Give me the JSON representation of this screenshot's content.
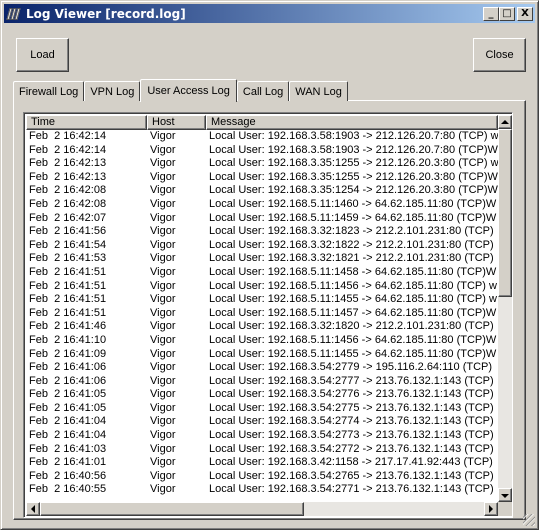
{
  "window": {
    "title": "Log Viewer [record.log]"
  },
  "title_buttons": {
    "minimize": "_",
    "maximize": "□",
    "close": "X"
  },
  "buttons": {
    "load": "Load",
    "close": "Close"
  },
  "tabs": [
    {
      "label": "Firewall Log",
      "active": false
    },
    {
      "label": "VPN Log",
      "active": false
    },
    {
      "label": "User Access Log",
      "active": true
    },
    {
      "label": "Call Log",
      "active": false
    },
    {
      "label": "WAN Log",
      "active": false
    }
  ],
  "table": {
    "columns": [
      "Time",
      "Host",
      "Message"
    ],
    "rows": [
      [
        "Feb  2 16:42:14",
        "Vigor",
        "Local User: 192.168.3.58:1903 -> 212.126.20.7:80 (TCP) w"
      ],
      [
        "Feb  2 16:42:14",
        "Vigor",
        "Local User: 192.168.3.58:1903 -> 212.126.20.7:80 (TCP)W"
      ],
      [
        "Feb  2 16:42:13",
        "Vigor",
        "Local User: 192.168.3.35:1255 -> 212.126.20.3:80 (TCP) w"
      ],
      [
        "Feb  2 16:42:13",
        "Vigor",
        "Local User: 192.168.3.35:1255 -> 212.126.20.3:80 (TCP)W"
      ],
      [
        "Feb  2 16:42:08",
        "Vigor",
        "Local User: 192.168.3.35:1254 -> 212.126.20.3:80 (TCP)W"
      ],
      [
        "Feb  2 16:42:08",
        "Vigor",
        "Local User: 192.168.5.11:1460 -> 64.62.185.11:80 (TCP)W"
      ],
      [
        "Feb  2 16:42:07",
        "Vigor",
        "Local User: 192.168.5.11:1459 -> 64.62.185.11:80 (TCP)W"
      ],
      [
        "Feb  2 16:41:56",
        "Vigor",
        "Local User: 192.168.3.32:1823 -> 212.2.101.231:80 (TCP)"
      ],
      [
        "Feb  2 16:41:54",
        "Vigor",
        "Local User: 192.168.3.32:1822 -> 212.2.101.231:80 (TCP)"
      ],
      [
        "Feb  2 16:41:53",
        "Vigor",
        "Local User: 192.168.3.32:1821 -> 212.2.101.231:80 (TCP)"
      ],
      [
        "Feb  2 16:41:51",
        "Vigor",
        "Local User: 192.168.5.11:1458 -> 64.62.185.11:80 (TCP)W"
      ],
      [
        "Feb  2 16:41:51",
        "Vigor",
        "Local User: 192.168.5.11:1456 -> 64.62.185.11:80 (TCP) w"
      ],
      [
        "Feb  2 16:41:51",
        "Vigor",
        "Local User: 192.168.5.11:1455 -> 64.62.185.11:80 (TCP) w"
      ],
      [
        "Feb  2 16:41:51",
        "Vigor",
        "Local User: 192.168.5.11:1457 -> 64.62.185.11:80 (TCP)W"
      ],
      [
        "Feb  2 16:41:46",
        "Vigor",
        "Local User: 192.168.3.32:1820 -> 212.2.101.231:80 (TCP)"
      ],
      [
        "Feb  2 16:41:10",
        "Vigor",
        "Local User: 192.168.5.11:1456 -> 64.62.185.11:80 (TCP)W"
      ],
      [
        "Feb  2 16:41:09",
        "Vigor",
        "Local User: 192.168.5.11:1455 -> 64.62.185.11:80 (TCP)W"
      ],
      [
        "Feb  2 16:41:06",
        "Vigor",
        "Local User: 192.168.3.54:2779 -> 195.116.2.64:110 (TCP)"
      ],
      [
        "Feb  2 16:41:06",
        "Vigor",
        "Local User: 192.168.3.54:2777 -> 213.76.132.1:143 (TCP)"
      ],
      [
        "Feb  2 16:41:05",
        "Vigor",
        "Local User: 192.168.3.54:2776 -> 213.76.132.1:143 (TCP)"
      ],
      [
        "Feb  2 16:41:05",
        "Vigor",
        "Local User: 192.168.3.54:2775 -> 213.76.132.1:143 (TCP)"
      ],
      [
        "Feb  2 16:41:04",
        "Vigor",
        "Local User: 192.168.3.54:2774 -> 213.76.132.1:143 (TCP)"
      ],
      [
        "Feb  2 16:41:04",
        "Vigor",
        "Local User: 192.168.3.54:2773 -> 213.76.132.1:143 (TCP)"
      ],
      [
        "Feb  2 16:41:03",
        "Vigor",
        "Local User: 192.168.3.54:2772 -> 213.76.132.1:143 (TCP)"
      ],
      [
        "Feb  2 16:41:01",
        "Vigor",
        "Local User: 192.168.3.42:1158 -> 217.17.41.92:443 (TCP)"
      ],
      [
        "Feb  2 16:40:56",
        "Vigor",
        "Local User: 192.168.3.54:2765 -> 213.76.132.1:143 (TCP)"
      ],
      [
        "Feb  2 16:40:55",
        "Vigor",
        "Local User: 192.168.3.54:2771 -> 213.76.132.1:143 (TCP)"
      ]
    ]
  },
  "colors": {
    "titlebar_start": "#0a246a",
    "titlebar_end": "#a6caf0",
    "face": "#d4d0c8"
  }
}
